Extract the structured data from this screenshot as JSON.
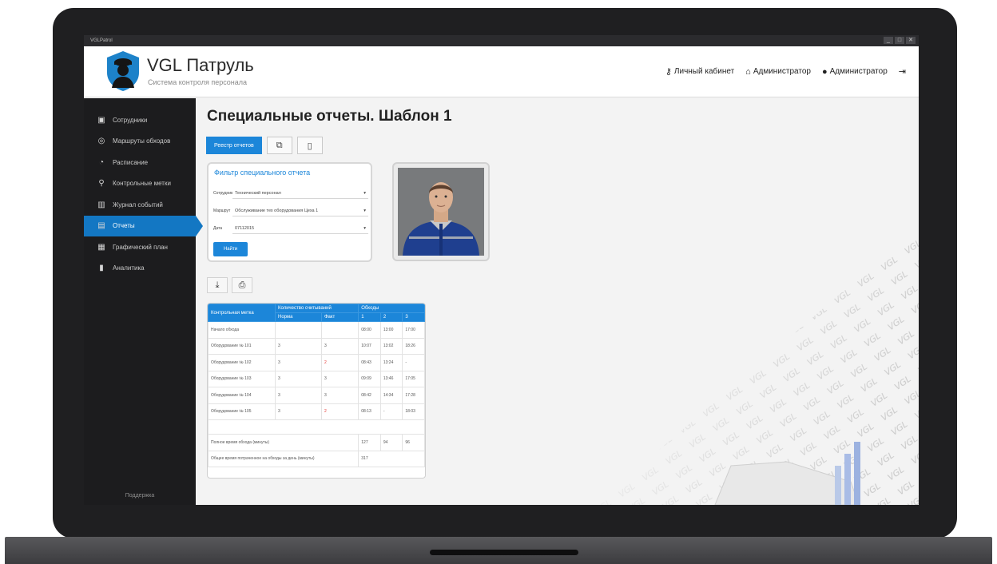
{
  "window": {
    "app_title": "VGLPatrol",
    "controls": [
      "_",
      "□",
      "✕"
    ]
  },
  "header": {
    "title": "VGL Патруль",
    "subtitle": "Система контроля персонала",
    "nav": {
      "cabinet": "Личный кабинет",
      "admin_role": "Администратор",
      "user": "Администратор"
    }
  },
  "sidebar": {
    "items": [
      {
        "label": "Сотрудники",
        "icon": "id-card-icon",
        "glyph": "▣"
      },
      {
        "label": "Маршруты обходов",
        "icon": "route-icon",
        "glyph": "◎"
      },
      {
        "label": "Расписание",
        "icon": "clock-icon",
        "glyph": "◔"
      },
      {
        "label": "Контрольные метки",
        "icon": "map-pin-icon",
        "glyph": "⚲"
      },
      {
        "label": "Журнал событий",
        "icon": "book-icon",
        "glyph": "▥"
      },
      {
        "label": "Отчеты",
        "icon": "report-icon",
        "glyph": "▤"
      },
      {
        "label": "Графический план",
        "icon": "map-icon",
        "glyph": "▦"
      },
      {
        "label": "Аналитика",
        "icon": "bar-chart-icon",
        "glyph": "▮"
      }
    ],
    "active_index": 5,
    "support": "Поддержка"
  },
  "main": {
    "title": "Специальные отчеты. Шаблон 1",
    "tabs": {
      "registry": "Реестр отчетов"
    },
    "filter": {
      "title": "Фильтр специального отчета",
      "employee_label": "Сотрудник",
      "employee_value": "Технический персонал",
      "route_label": "Маршрут",
      "route_value": "Обслуживание тех оборудования Цеха 1",
      "date_label": "Дата",
      "date_value": "07112015",
      "find_button": "Найти"
    },
    "table": {
      "headers": {
        "checkpoint": "Контрольная метка",
        "reads_count": "Количество считываний",
        "norm": "Норма",
        "fact": "Факт",
        "rounds": "Обходы",
        "r1": "1",
        "r2": "2",
        "r3": "3"
      },
      "rows": [
        {
          "name": "Начало обхода",
          "norm": "",
          "fact": "",
          "r1": "08:00",
          "r2": "13:00",
          "r3": "17:00"
        },
        {
          "name": "Оборудование № 101",
          "norm": "3",
          "fact": "3",
          "r1": "10:07",
          "r2": "13:02",
          "r3": "18:26"
        },
        {
          "name": "Оборудование № 102",
          "norm": "3",
          "fact": "2",
          "r1": "08:43",
          "r2": "13:24",
          "r3": "-"
        },
        {
          "name": "Оборудование № 103",
          "norm": "3",
          "fact": "3",
          "r1": "09:09",
          "r2": "13:46",
          "r3": "17:05"
        },
        {
          "name": "Оборудование № 104",
          "norm": "3",
          "fact": "3",
          "r1": "08:42",
          "r2": "14:34",
          "r3": "17:28"
        },
        {
          "name": "Оборудование № 105",
          "norm": "3",
          "fact": "2",
          "r1": "08:13",
          "r2": "-",
          "r3": "18:03"
        }
      ],
      "total_label": "Полное время обхода (минуты)",
      "totals": {
        "r1": "127",
        "r2": "94",
        "r3": "96"
      },
      "day_total_label": "Общее время потраченное на обходы за день (минуты)",
      "day_total_value": "317"
    }
  },
  "colors": {
    "accent": "#1c86d9",
    "sidebar_bg": "#1c1c1e",
    "alert": "#e53935"
  }
}
